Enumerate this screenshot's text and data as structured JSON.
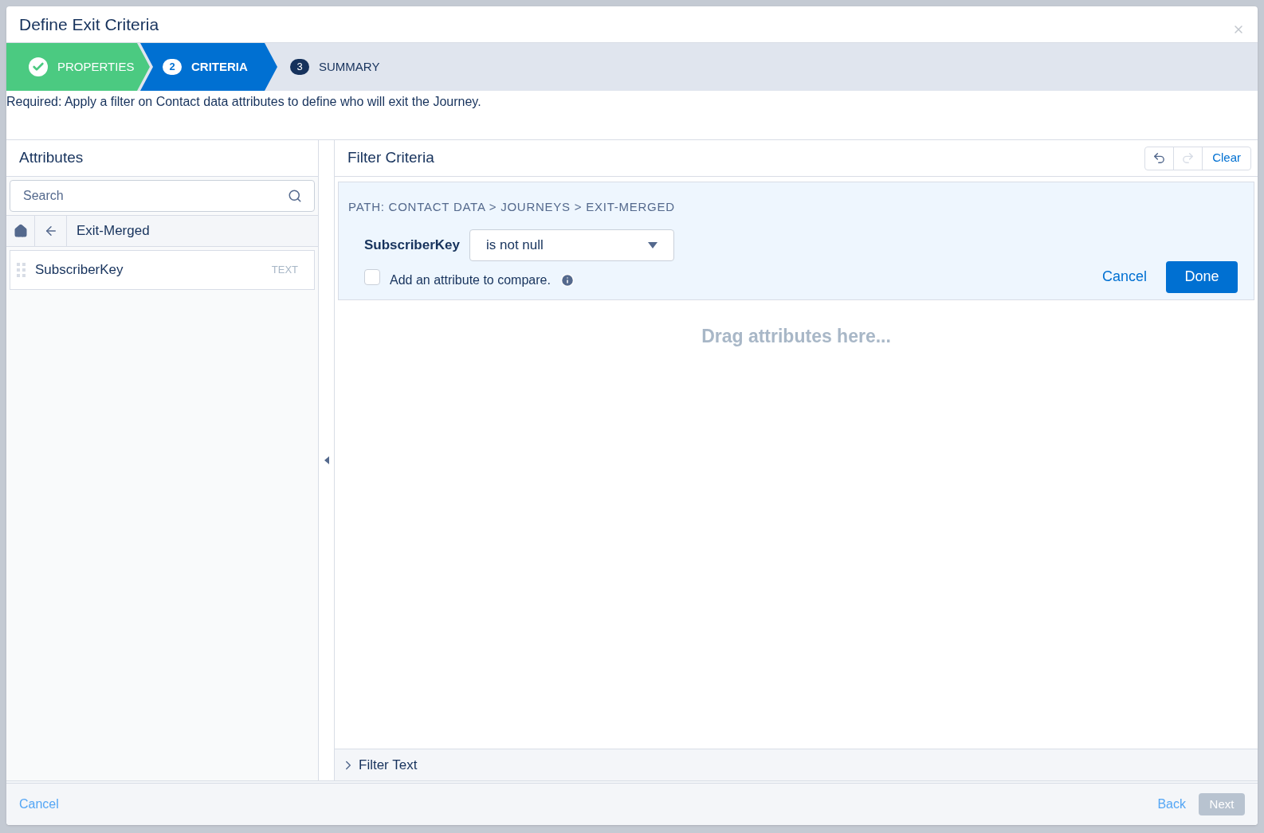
{
  "window": {
    "title": "Define Exit Criteria"
  },
  "steps": [
    {
      "label": "PROPERTIES",
      "kind": "done",
      "selected": false
    },
    {
      "number": "2",
      "label": "CRITERIA",
      "kind": "current",
      "selected": true
    },
    {
      "number": "3",
      "label": "SUMMARY",
      "kind": "upcoming",
      "selected": false
    }
  ],
  "instruction": "Required: Apply a filter on Contact data attributes to define who will exit the Journey.",
  "attributes": {
    "title": "Attributes",
    "search": {
      "placeholder": "Search"
    },
    "folder": "Exit-Merged",
    "items": [
      {
        "name": "SubscriberKey",
        "type": "TEXT"
      }
    ]
  },
  "filter": {
    "title": "Filter Criteria",
    "undo_disabled": false,
    "redo_disabled": true,
    "clear": "Clear",
    "path": "PATH: CONTACT DATA > JOURNEYS > EXIT-MERGED",
    "attribute": "SubscriberKey",
    "operator": "is not null",
    "compare": {
      "label": "Add an attribute to compare.",
      "checked": false
    },
    "cancel": "Cancel",
    "done": "Done",
    "dropzone": "Drag attributes here...",
    "filter_text": {
      "label": "Filter Text",
      "expanded": false
    }
  },
  "footer": {
    "cancel": "Cancel",
    "back": "Back",
    "next": {
      "label": "Next",
      "disabled": true
    }
  }
}
